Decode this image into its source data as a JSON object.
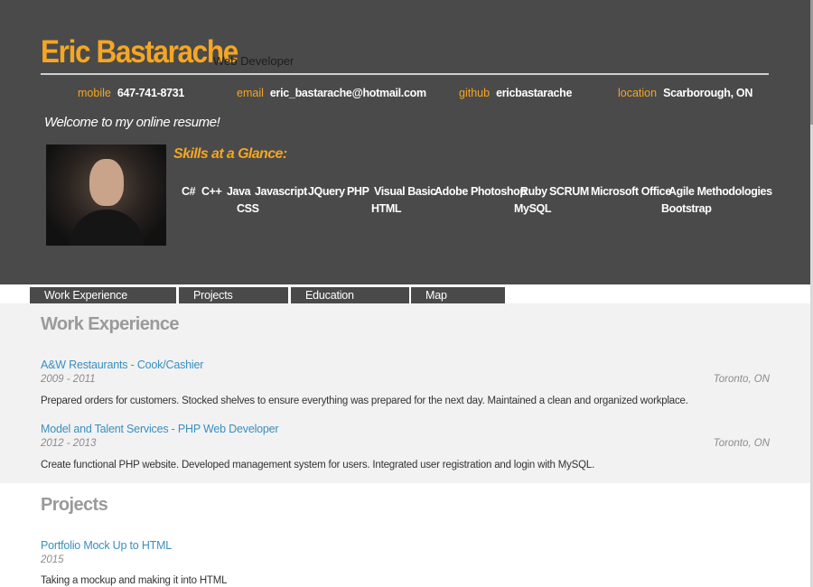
{
  "header": {
    "name": "Eric Bastarache",
    "role": "Web Developer",
    "contacts": [
      {
        "label": "mobile",
        "value": "647-741-8731"
      },
      {
        "label": "email",
        "value": "eric_bastarache@hotmail.com"
      },
      {
        "label": "github",
        "value": "ericbastarache"
      },
      {
        "label": "location",
        "value": "Scarborough, ON"
      }
    ],
    "welcome": "Welcome to my online resume!",
    "skills_title": "Skills at a Glance:",
    "skills": [
      "C#",
      "C++",
      "Java",
      "Javascript",
      "JQuery",
      "PHP",
      "Visual Basic",
      "Adobe Photoshop",
      "Ruby",
      "SCRUM",
      "Microsoft Office",
      "Agile Methodologies",
      "CSS",
      "HTML",
      "MySQL",
      "Bootstrap"
    ]
  },
  "tabs": [
    "Work Experience",
    "Projects",
    "Education",
    "Map"
  ],
  "work": {
    "title": "Work Experience",
    "items": [
      {
        "title": "A&W Restaurants - Cook/Cashier",
        "dates": "2009 - 2011",
        "location": "Toronto, ON",
        "description": "Prepared orders for customers. Stocked shelves to ensure everything was prepared for the next day. Maintained a clean and organized workplace."
      },
      {
        "title": "Model and Talent Services - PHP Web Developer",
        "dates": "2012 - 2013",
        "location": "Toronto, ON",
        "description": "Create functional PHP website. Developed management system for users. Integrated user registration and login with MySQL."
      }
    ]
  },
  "projects": {
    "title": "Projects",
    "items": [
      {
        "title": "Portfolio Mock Up to HTML",
        "dates": "2015",
        "description": "Taking a mockup and making it into HTML"
      }
    ]
  },
  "colors": {
    "header_bg": "#4a4a4a",
    "accent": "#f5a623",
    "link": "#3a8fc0",
    "section_title": "#9a9a9a",
    "work_bg": "#f2f2f2"
  },
  "icons": {
    "profile_photo": "avatar"
  }
}
